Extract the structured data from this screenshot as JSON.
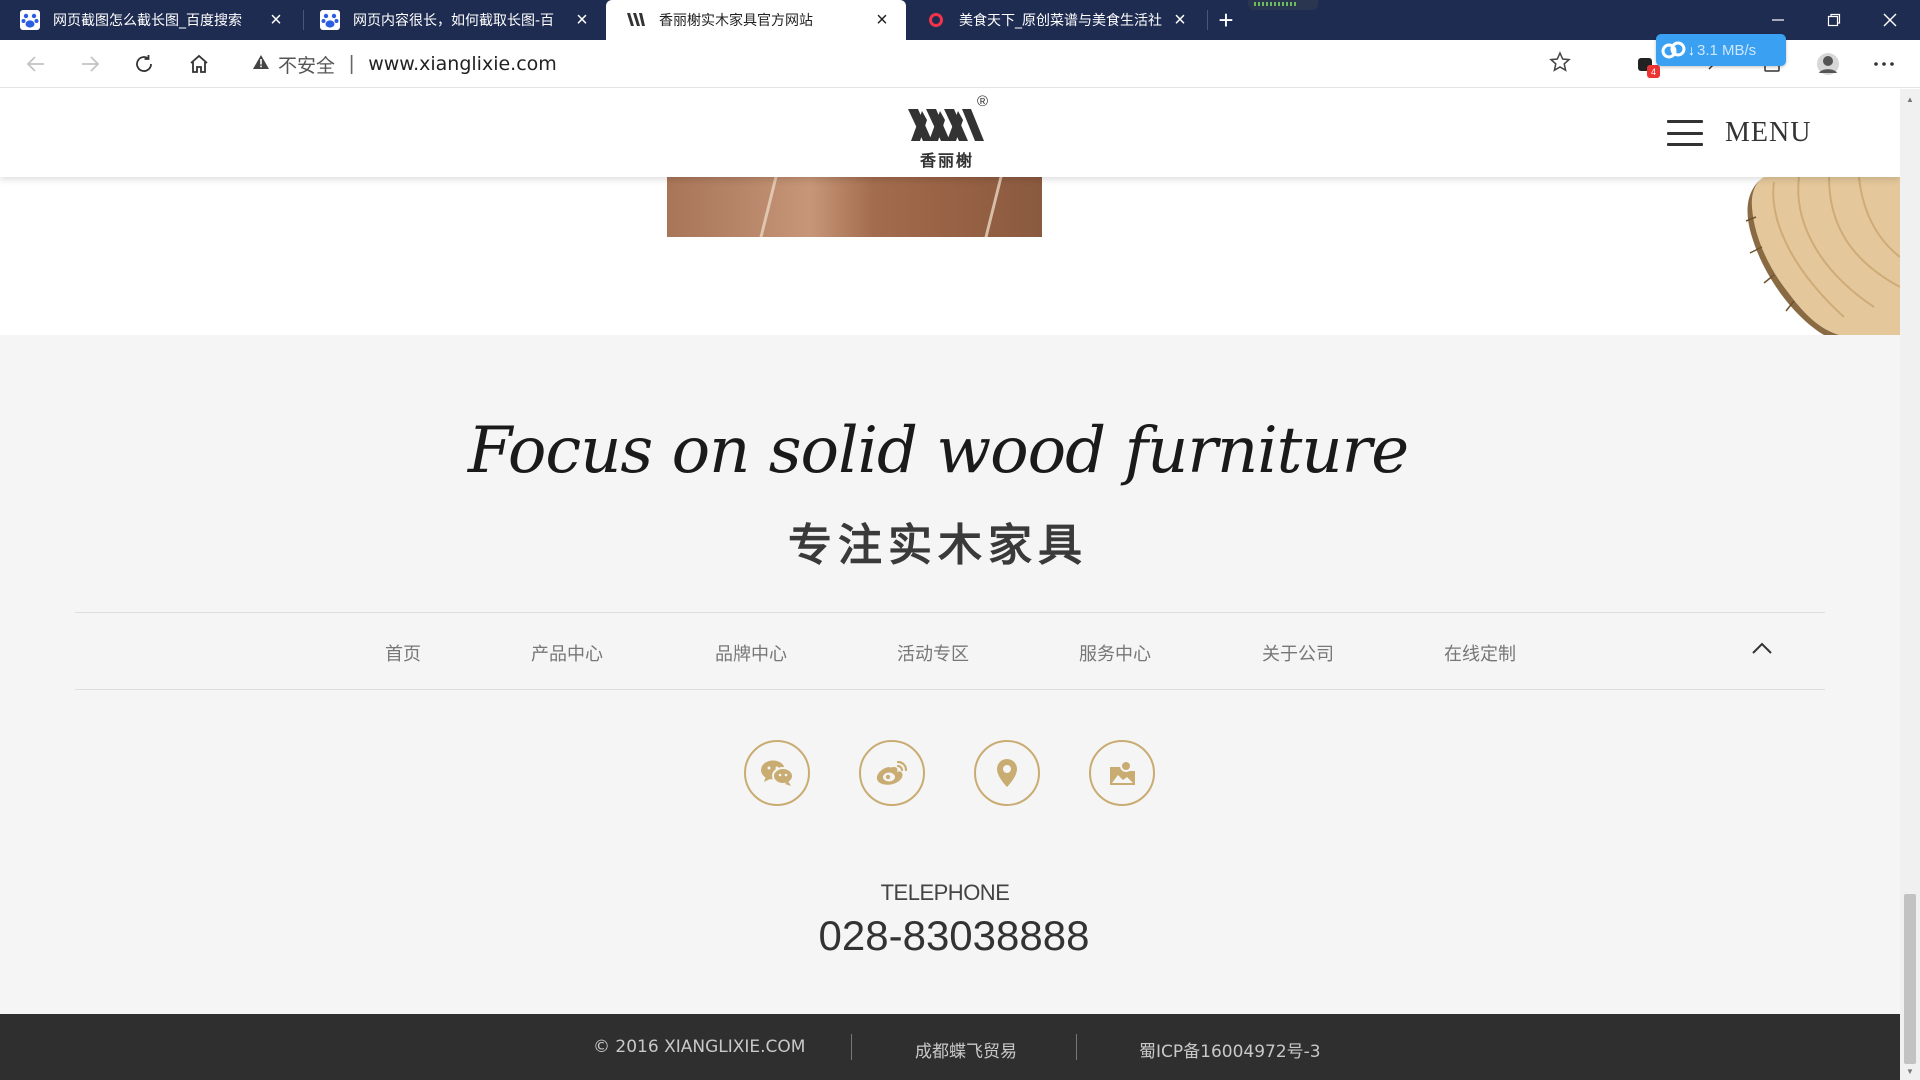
{
  "browser": {
    "tabs": [
      {
        "title": "网页截图怎么截长图_百度搜索",
        "favicon": "baidu-paw-icon",
        "active": false
      },
      {
        "title": "网页内容很长，如何截取长图-百",
        "favicon": "baidu-paw-icon",
        "active": false
      },
      {
        "title": "香丽榭实木家具官方网站",
        "favicon": "xianglixie-logo-icon",
        "active": true
      },
      {
        "title": "美食天下_原创菜谱与美食生活社",
        "favicon": "meishi-ring-icon",
        "active": false
      }
    ],
    "new_tab_label": "+",
    "address": {
      "security_label": "不安全",
      "url": "www.xianglixie.com"
    },
    "extension_badge": "4",
    "download_speed": "3.1 MB/s",
    "colors": {
      "tabstrip": "#1f2c52",
      "download_pill": "#3aa0f2"
    }
  },
  "site": {
    "header": {
      "logo_text": "香丽榭",
      "logo_mark": "®",
      "menu_label": "MENU"
    },
    "slogan": {
      "english": "Focus on solid wood furniture",
      "chinese": "专注实木家具"
    },
    "footer_nav": [
      "首页",
      "产品中心",
      "品牌中心",
      "活动专区",
      "服务中心",
      "关于公司",
      "在线定制"
    ],
    "social_icons": [
      "wechat-icon",
      "weibo-icon",
      "location-pin-icon",
      "gallery-icon"
    ],
    "contact": {
      "label": "TELEPHONE",
      "number": "028-83038888"
    },
    "copyright": {
      "notice": "© 2016 XIANGLIXIE.COM",
      "company": "成都蝶飞贸易",
      "icp": "蜀ICP备16004972号-3"
    },
    "colors": {
      "accent_gold": "#c9ac72",
      "footer_bar": "#2f2f2f",
      "page_bg": "#f5f5f5"
    }
  }
}
